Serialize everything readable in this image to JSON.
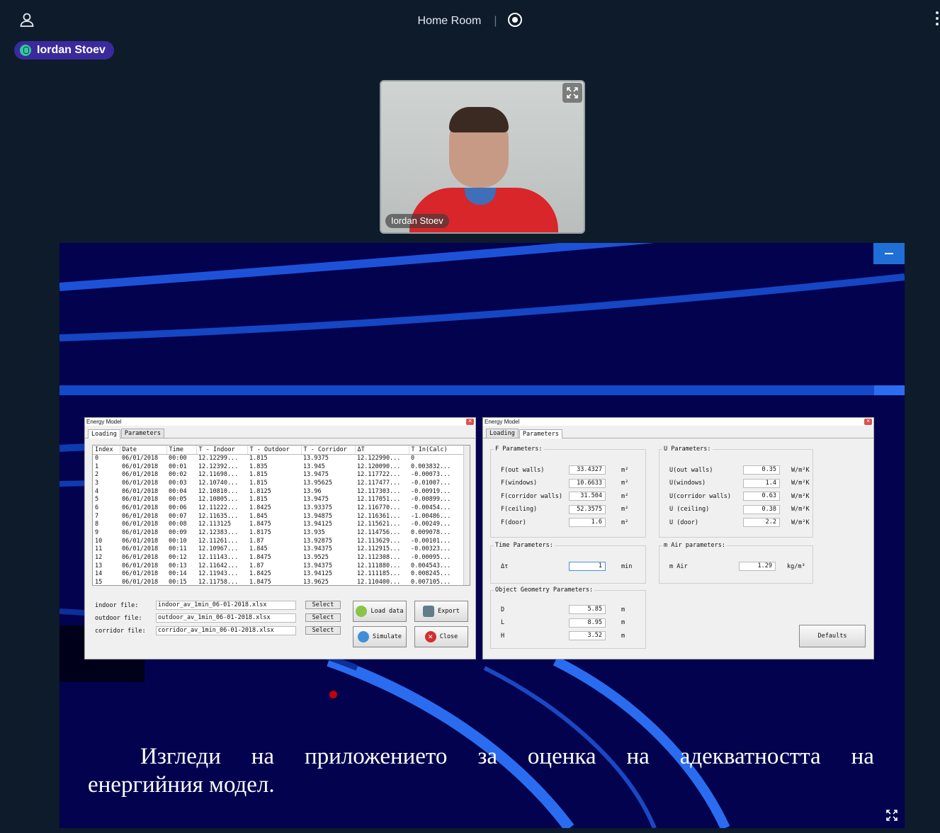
{
  "header": {
    "room_name": "Home Room",
    "separator": "|"
  },
  "speaker": {
    "name": "Iordan Stoev"
  },
  "video": {
    "participant_name": "Iordan Stoev"
  },
  "colors": {
    "slide_bg": "#02024f",
    "badge": "#3a2a9c",
    "accent": "#1f6fd6"
  },
  "slide": {
    "caption_line1": [
      "Изгледи",
      "на",
      "приложението",
      "за",
      "оценка",
      "на",
      "адекватността",
      "на"
    ],
    "caption_line2": "енергийния модел.",
    "loading_window": {
      "title": "Energy Model",
      "tabs": [
        "Loading",
        "Parameters"
      ],
      "columns": [
        "Index",
        "Date",
        "Time",
        "T - Indoor",
        "T - Outdoor",
        "T - Corridor",
        "ΔT",
        "T In(Calc)"
      ],
      "rows": [
        [
          "0",
          "06/01/2018",
          "00:00",
          "12.12299...",
          "1.815",
          "13.9375",
          "12.122990...",
          "0"
        ],
        [
          "1",
          "06/01/2018",
          "00:01",
          "12.12392...",
          "1.835",
          "13.945",
          "12.120090...",
          "0.003832..."
        ],
        [
          "2",
          "06/01/2018",
          "00:02",
          "12.11698...",
          "1.815",
          "13.9475",
          "12.117722...",
          "-0.00073..."
        ],
        [
          "3",
          "06/01/2018",
          "00:03",
          "12.10740...",
          "1.815",
          "13.95625",
          "12.117477...",
          "-0.01007..."
        ],
        [
          "4",
          "06/01/2018",
          "00:04",
          "12.10810...",
          "1.8125",
          "13.96",
          "12.117303...",
          "-0.00919..."
        ],
        [
          "5",
          "06/01/2018",
          "00:05",
          "12.10805...",
          "1.815",
          "13.9475",
          "12.117051...",
          "-0.00899..."
        ],
        [
          "6",
          "06/01/2018",
          "00:06",
          "12.11222...",
          "1.8425",
          "13.93375",
          "12.116770...",
          "-0.00454..."
        ],
        [
          "7",
          "06/01/2018",
          "00:07",
          "12.11635...",
          "1.845",
          "13.94875",
          "12.116361...",
          "-1.00486..."
        ],
        [
          "8",
          "06/01/2018",
          "00:08",
          "12.113125",
          "1.8475",
          "13.94125",
          "12.115621...",
          "-0.00249..."
        ],
        [
          "9",
          "06/01/2018",
          "00:09",
          "12.12383...",
          "1.8175",
          "13.935",
          "12.114756...",
          "0.009078..."
        ],
        [
          "10",
          "06/01/2018",
          "00:10",
          "12.11261...",
          "1.87",
          "13.92875",
          "12.113629...",
          "-0.00101..."
        ],
        [
          "11",
          "06/01/2018",
          "00:11",
          "12.10967...",
          "1.845",
          "13.94375",
          "12.112915...",
          "-0.00323..."
        ],
        [
          "12",
          "06/01/2018",
          "00:12",
          "12.11143...",
          "1.8475",
          "13.9525",
          "12.112308...",
          "-0.00095..."
        ],
        [
          "13",
          "06/01/2018",
          "00:13",
          "12.11642...",
          "1.87",
          "13.94375",
          "12.111880...",
          "0.004543..."
        ],
        [
          "14",
          "06/01/2018",
          "00:14",
          "12.11943...",
          "1.8425",
          "13.94125",
          "12.111185...",
          "0.008245..."
        ],
        [
          "15",
          "06/01/2018",
          "00:15",
          "12.11758...",
          "1.8475",
          "13.9625",
          "12.110400...",
          "0.007105..."
        ]
      ],
      "files": [
        {
          "label": "indoor file:",
          "value": "indoor_av_1min_06-01-2018.xlsx"
        },
        {
          "label": "outdoor file:",
          "value": "outdoor_av_1min_06-01-2018.xlsx"
        },
        {
          "label": "corridor file:",
          "value": "corridor_av_1min_06-01-2018.xlsx"
        }
      ],
      "select_label": "Select",
      "buttons": {
        "load": "Load data",
        "export": "Export",
        "simulate": "Simulate",
        "close": "Close"
      }
    },
    "params_window": {
      "title": "Energy Model",
      "tabs": [
        "Loading",
        "Parameters"
      ],
      "f_group": {
        "title": "F Parameters:",
        "rows": [
          {
            "label": "F(out walls)",
            "value": "33.4327",
            "unit": "m²"
          },
          {
            "label": "F(windows)",
            "value": "10.6633",
            "unit": "m²"
          },
          {
            "label": "F(corridor walls)",
            "value": "31.504",
            "unit": "m²"
          },
          {
            "label": "F(ceiling)",
            "value": "52.3575",
            "unit": "m²"
          },
          {
            "label": "F(door)",
            "value": "1.6",
            "unit": "m²"
          }
        ]
      },
      "u_group": {
        "title": "U Parameters:",
        "rows": [
          {
            "label": "U(out walls)",
            "value": "0.35",
            "unit": "W/m²K"
          },
          {
            "label": "U(windows)",
            "value": "1.4",
            "unit": "W/m²K"
          },
          {
            "label": "U(corridor walls)",
            "value": "0.63",
            "unit": "W/m²K"
          },
          {
            "label": "U (ceiling)",
            "value": "0.38",
            "unit": "W/m²K"
          },
          {
            "label": "U (door)",
            "value": "2.2",
            "unit": "W/m²K"
          }
        ]
      },
      "time_group": {
        "title": "Time Parameters:",
        "label": "Δτ",
        "value": "1",
        "unit": "min"
      },
      "air_group": {
        "title": "m Air parameters:",
        "label": "m Air",
        "value": "1.29",
        "unit": "kg/m³"
      },
      "geom_group": {
        "title": "Object Geometry Parameters:",
        "rows": [
          {
            "label": "D",
            "value": "5.85",
            "unit": "m"
          },
          {
            "label": "L",
            "value": "8.95",
            "unit": "m"
          },
          {
            "label": "H",
            "value": "3.52",
            "unit": "m"
          }
        ]
      },
      "defaults_label": "Defaults"
    }
  }
}
